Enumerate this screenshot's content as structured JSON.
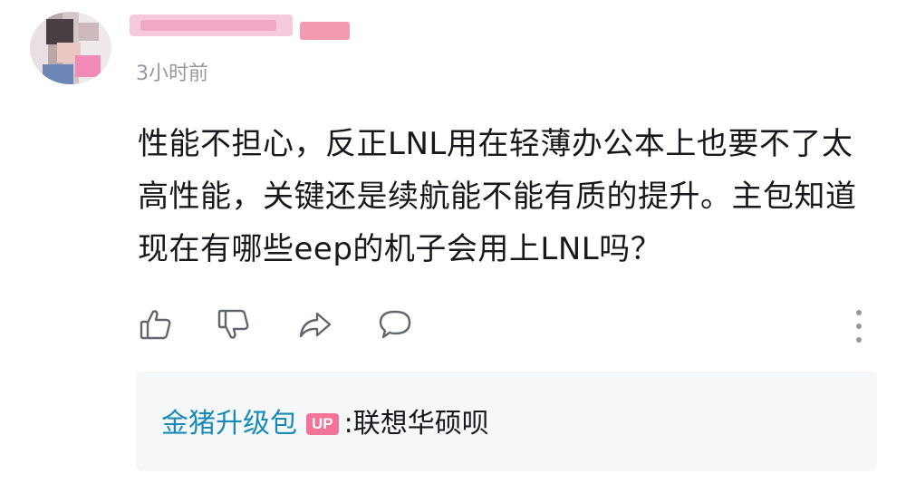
{
  "comment": {
    "timestamp": "3小时前",
    "text": "性能不担心，反正LNL用在轻薄办公本上也要不了太高性能，关键还是续航能不能有质的提升。主包知道现在有哪些eep的机子会用上LNL吗？"
  },
  "actions": {
    "icons": [
      "thumbs-up-icon",
      "thumbs-down-icon",
      "share-icon",
      "comment-icon",
      "more-icon"
    ]
  },
  "reply": {
    "username": "金猪升级包",
    "badge": "UP",
    "colon": ":",
    "text": "联想华硕呗"
  },
  "colors": {
    "reply_username": "#178bb6",
    "badge": "#f27499",
    "timestamp": "#9499a0",
    "reply_background": "#f6f7f8"
  }
}
